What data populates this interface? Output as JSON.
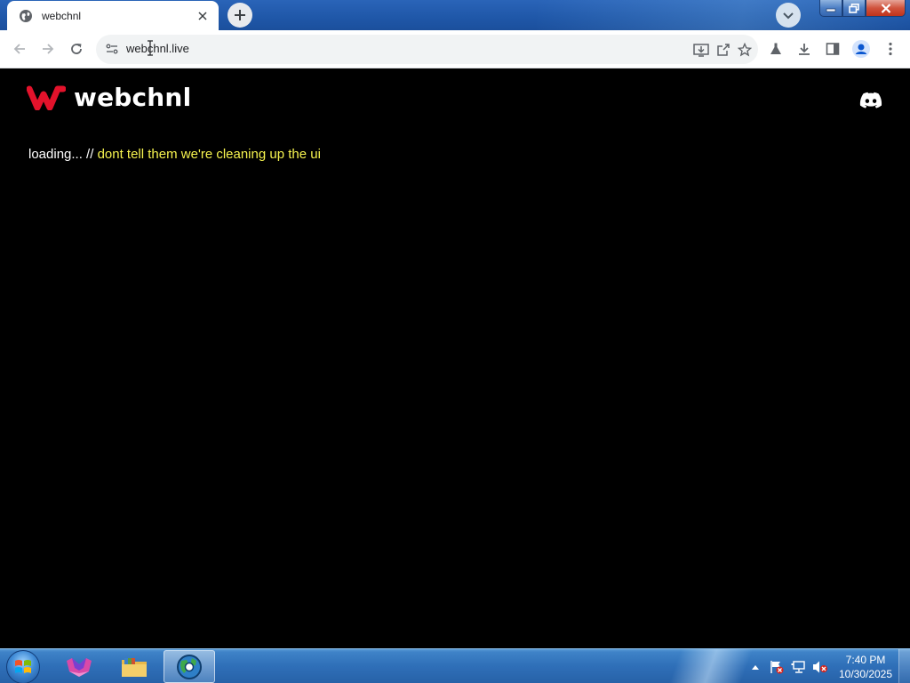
{
  "browser": {
    "tab": {
      "title": "webchnl",
      "favicon": "globe-icon"
    },
    "address_bar": {
      "url": "webchnl.live"
    }
  },
  "page": {
    "logo_text": "webchnl",
    "loading_prefix": "loading... // ",
    "loading_note": "dont tell them we're cleaning up the ui"
  },
  "taskbar": {
    "time": "7:40 PM",
    "date": "10/30/2025"
  },
  "colors": {
    "brand_red": "#e3122b",
    "loading_note_yellow": "#f5f24e",
    "page_background": "#000000"
  }
}
